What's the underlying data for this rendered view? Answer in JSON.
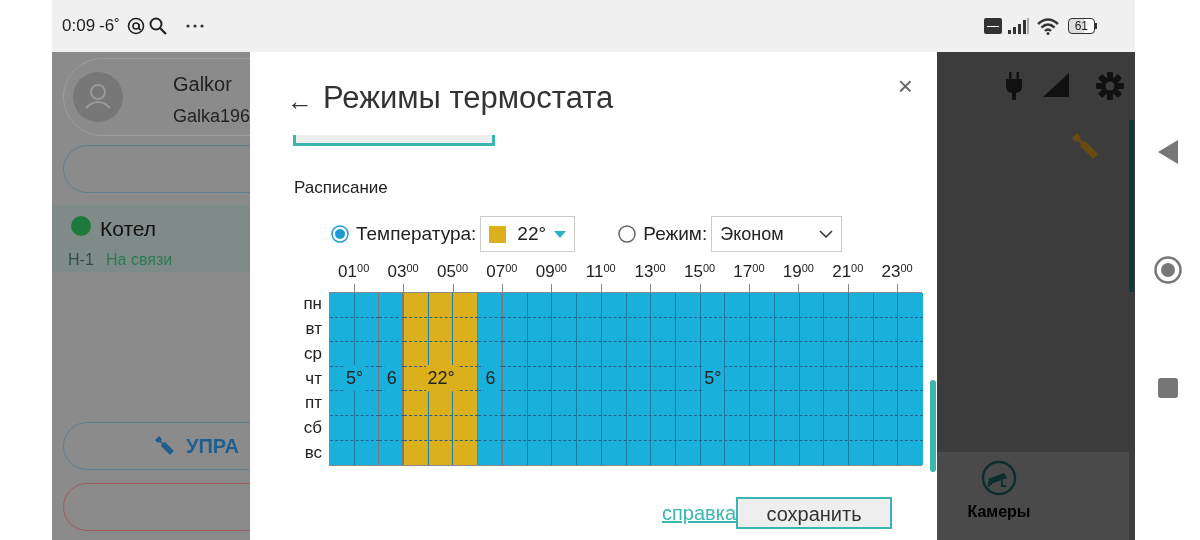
{
  "status_bar": {
    "time": "0:09",
    "temperature": "-6˚",
    "battery": "61"
  },
  "background": {
    "user": {
      "name": "Galkor",
      "login": "Galka196"
    },
    "device": {
      "name": "Котел",
      "color": "#1e7a3c",
      "code": "Н-1",
      "status": "На связи"
    },
    "manage_button": "УПРА",
    "tab": "Камеры"
  },
  "dialog": {
    "back": "←",
    "title": "Режимы термостата",
    "close": "×",
    "section": "Расписание",
    "options": [
      {
        "kind": "color",
        "label": "Температура:",
        "selected": true,
        "value": "22°",
        "color": "#dbb01c"
      },
      {
        "kind": "text",
        "label": "Режим:",
        "selected": false,
        "value": "Эконом"
      }
    ],
    "hours": [
      "01$^{00}$",
      "03$^{00}$",
      "05$^{00}$",
      "07$^{00}$",
      "09$^{00}$",
      "11$^{00}$",
      "13$^{00}$",
      "15$^{00}$",
      "17$^{00}$",
      "19$^{00}$",
      "21$^{00}$",
      "23$^{00}$"
    ],
    "days": [
      "пн",
      "вт",
      "ср",
      "чт",
      "пт",
      "сб",
      "вс"
    ],
    "segments": [
      {
        "label": "5°",
        "color": "#1ab0dc",
        "hours": [
          {
            "kind": "hour"
          },
          {
            "kind": "hour"
          }
        ]
      },
      {
        "label": "6",
        "color": "#1ab0dc",
        "hours": [
          {
            "kind": "hour"
          }
        ]
      },
      {
        "label": "22°",
        "color": "#dbb01c",
        "hours": [
          {
            "kind": "hour"
          },
          {
            "kind": "hour"
          },
          {
            "kind": "hour"
          }
        ]
      },
      {
        "label": "6",
        "color": "#1ab0dc",
        "hours": [
          {
            "kind": "hour"
          }
        ]
      },
      {
        "label": "5°",
        "color": "#1ab0dc",
        "hours": [
          {
            "kind": "hour"
          },
          {
            "kind": "hour"
          },
          {
            "kind": "hour"
          },
          {
            "kind": "hour"
          },
          {
            "kind": "hour"
          },
          {
            "kind": "hour"
          },
          {
            "kind": "hour"
          },
          {
            "kind": "hour"
          },
          {
            "kind": "hour"
          },
          {
            "kind": "hour"
          },
          {
            "kind": "hour"
          },
          {
            "kind": "hour"
          },
          {
            "kind": "hour"
          },
          {
            "kind": "hour"
          },
          {
            "kind": "hour"
          },
          {
            "kind": "hour"
          },
          {
            "kind": "hour"
          }
        ]
      }
    ],
    "help_link": "справка",
    "save_button": "сохранить"
  }
}
